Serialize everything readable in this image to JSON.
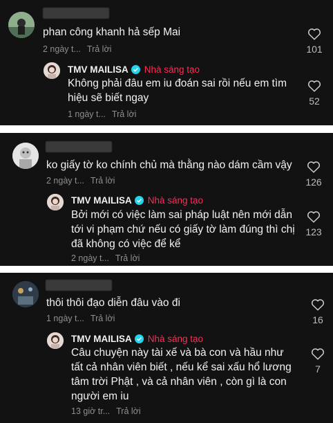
{
  "colors": {
    "background": "#121212",
    "text": "#f2f2f2",
    "meta": "#8f8f8f",
    "creator_badge": "#fe2c55",
    "verified": "#20d5ec"
  },
  "threads": [
    {
      "comment": {
        "text": "phan công khanh hả sếp Mai",
        "time": "2 ngày t...",
        "reply": "Trả lời",
        "likes": "101"
      },
      "reply": {
        "author": "TMV MAILISA",
        "badge": "Nhà sáng tạo",
        "text_lines": [
          "Không phải đâu em iu đoán sai rồi nếu em tìm",
          "hiệu sẽ biết ngay"
        ],
        "time": "1 ngày t...",
        "reply": "Trả lời",
        "likes": "52"
      }
    },
    {
      "comment": {
        "text": "ko giấy tờ ko chính chủ mà thằng nào dám cầm vậy",
        "time": "2 ngày t...",
        "reply": "Trả lời",
        "likes": "126"
      },
      "reply": {
        "author": "TMV MAILISA",
        "badge": "Nhà sáng tạo",
        "text_lines": [
          "Bởi mới có việc làm sai pháp luật nên mới dẫn",
          "tới vi phạm chứ nếu có giấy tờ làm đúng thì chị",
          "đã không có việc để kể"
        ],
        "time": "2 ngày t...",
        "reply": "Trả lời",
        "likes": "123"
      }
    },
    {
      "comment": {
        "text": "thôi thôi đạo diễn đâu vào đi",
        "time": "1 ngày t...",
        "reply": "Trả lời",
        "likes": "16"
      },
      "reply": {
        "author": "TMV MAILISA",
        "badge": "Nhà sáng tạo",
        "text_lines": [
          "Câu chuyện này tài xế và bà con và hầu như",
          "tất cả nhân viên biết , nếu kể sai xấu hổ lương",
          "tâm trời Phật , và cả nhân viên , còn gì là con",
          "người em iu"
        ],
        "time": "13 giờ tr...",
        "reply": "Trả lời",
        "likes": "7"
      }
    }
  ]
}
